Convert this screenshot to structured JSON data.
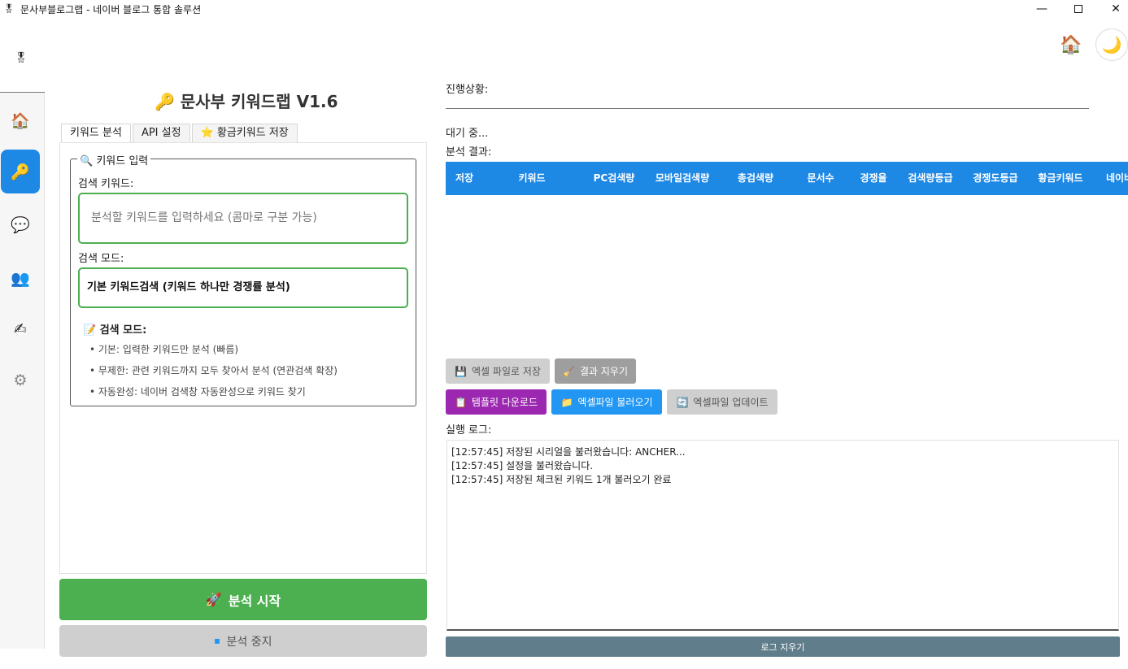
{
  "window": {
    "title": "문사부블로그랩 - 네이버 블로그 통합 솔루션",
    "app_icon": "🎖",
    "minimize": "—",
    "close": "✕"
  },
  "header": {
    "home_icon": "🏠",
    "theme_icon": "🌙"
  },
  "sidebar": {
    "logo": "🎖",
    "items": [
      {
        "name": "home-icon",
        "glyph": "🏠"
      },
      {
        "name": "key-icon",
        "glyph": "🔑"
      },
      {
        "name": "chat-icon",
        "glyph": "💬"
      },
      {
        "name": "users-icon",
        "glyph": "👥"
      },
      {
        "name": "write-icon",
        "glyph": "✍"
      },
      {
        "name": "gear-icon",
        "glyph": "⚙"
      }
    ]
  },
  "left": {
    "app_title": "🔑 문사부 키워드랩 V1.6",
    "tabs": [
      {
        "label": "키워드 분석"
      },
      {
        "label": "API 설정"
      },
      {
        "label": "⭐ 황금키워드 저장"
      }
    ],
    "group_title": "🔍 키워드 입력",
    "keyword_label": "검색 키워드:",
    "keyword_placeholder": "분석할 키워드를 입력하세요 (콤마로 구분 가능)",
    "mode_label": "검색 모드:",
    "mode_value": "기본 키워드검색 (키워드 하나만 경쟁률 분석)",
    "mode_help_title": "📝 검색 모드:",
    "mode_help_items": [
      "• 기본: 입력한 키워드만 분석 (빠름)",
      "• 무제한: 관련 키워드까지 모두 찾아서 분석 (연관검색 확장)",
      "• 자동완성: 네이버 검색창 자동완성으로 키워드 찾기"
    ],
    "start_button": "분석 시작",
    "start_icon": "🚀",
    "stop_button": "분석 중지",
    "stop_icon": "⏹"
  },
  "right": {
    "progress_label": "진행상황:",
    "status_text": "대기 중...",
    "results_label": "분석 결과:",
    "table_headers": [
      "저장",
      "키워드",
      "PC검색량",
      "모바일검색량",
      "총검색량",
      "문서수",
      "경쟁율",
      "검색량등급",
      "경쟁도등급",
      "황금키워드",
      "네이버"
    ],
    "buttons": {
      "excel_save": "엑셀 파일로 저장",
      "excel_save_icon": "💾",
      "clear_results": "결과 지우기",
      "clear_results_icon": "🧹",
      "template": "템플릿 다운로드",
      "template_icon": "📋",
      "load_excel": "엑셀파일 불러오기",
      "load_excel_icon": "📁",
      "update_excel": "엑셀파일 업데이트",
      "update_excel_icon": "🔄"
    },
    "log_label": "실행 로그:",
    "log_lines": [
      "[12:57:45] 저장된 시리얼을 불러왔습니다: ANCHER...",
      "[12:57:45] 설정을 불러왔습니다.",
      "[12:57:45] 저장된 체크된 키워드 1개 불러오기 완료"
    ],
    "clear_log": "로그 지우기"
  }
}
